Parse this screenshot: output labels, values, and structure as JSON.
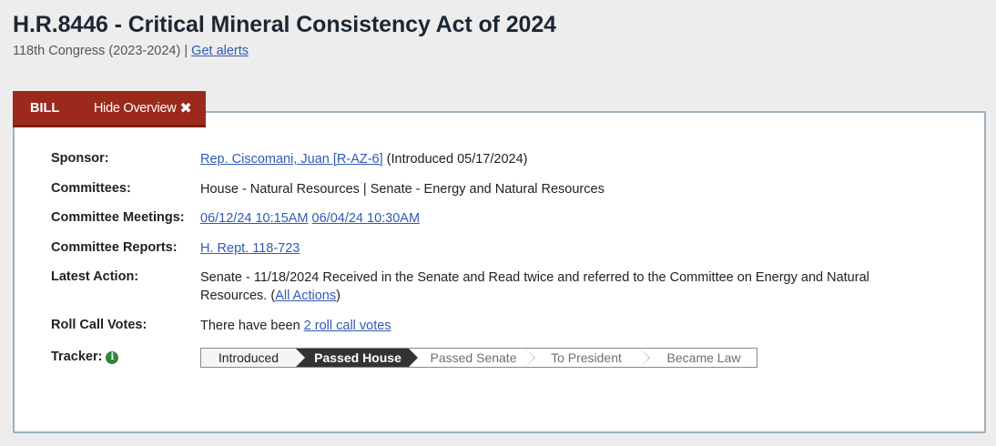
{
  "header": {
    "title": "H.R.8446 - Critical Mineral Consistency Act of 2024",
    "congress": "118th Congress (2023-2024)",
    "separator": "|",
    "alerts_link": "Get alerts"
  },
  "tabs": {
    "bill_label": "BILL",
    "hide_overview_label": "Hide Overview",
    "hide_icon": "✖"
  },
  "overview": {
    "sponsor": {
      "label": "Sponsor:",
      "link": "Rep. Ciscomani, Juan [R-AZ-6]",
      "text": " (Introduced 05/17/2024)"
    },
    "committees": {
      "label": "Committees:",
      "text": "House - Natural Resources | Senate - Energy and Natural Resources"
    },
    "committee_meetings": {
      "label": "Committee Meetings:",
      "links": [
        "06/12/24 10:15AM",
        "06/04/24 10:30AM"
      ]
    },
    "committee_reports": {
      "label": "Committee Reports:",
      "link": "H. Rept. 118-723"
    },
    "latest_action": {
      "label": "Latest Action:",
      "text": "Senate - 11/18/2024 Received in the Senate and Read twice and referred to the Committee on Energy and Natural Resources.  (",
      "link": "All Actions",
      "close": ")"
    },
    "roll_call": {
      "label": "Roll Call Votes:",
      "text": "There have been ",
      "link": "2 roll call votes"
    },
    "tracker": {
      "label": "Tracker:",
      "info_icon": "i",
      "steps": [
        "Introduced",
        "Passed House",
        "Passed Senate",
        "To President",
        "Became Law"
      ],
      "current_step": "Passed House"
    }
  },
  "colors": {
    "tab_bg": "#9b2a1c",
    "link": "#2f5bb7",
    "tracker_current": "#333333",
    "info_icon": "#2e8540"
  }
}
